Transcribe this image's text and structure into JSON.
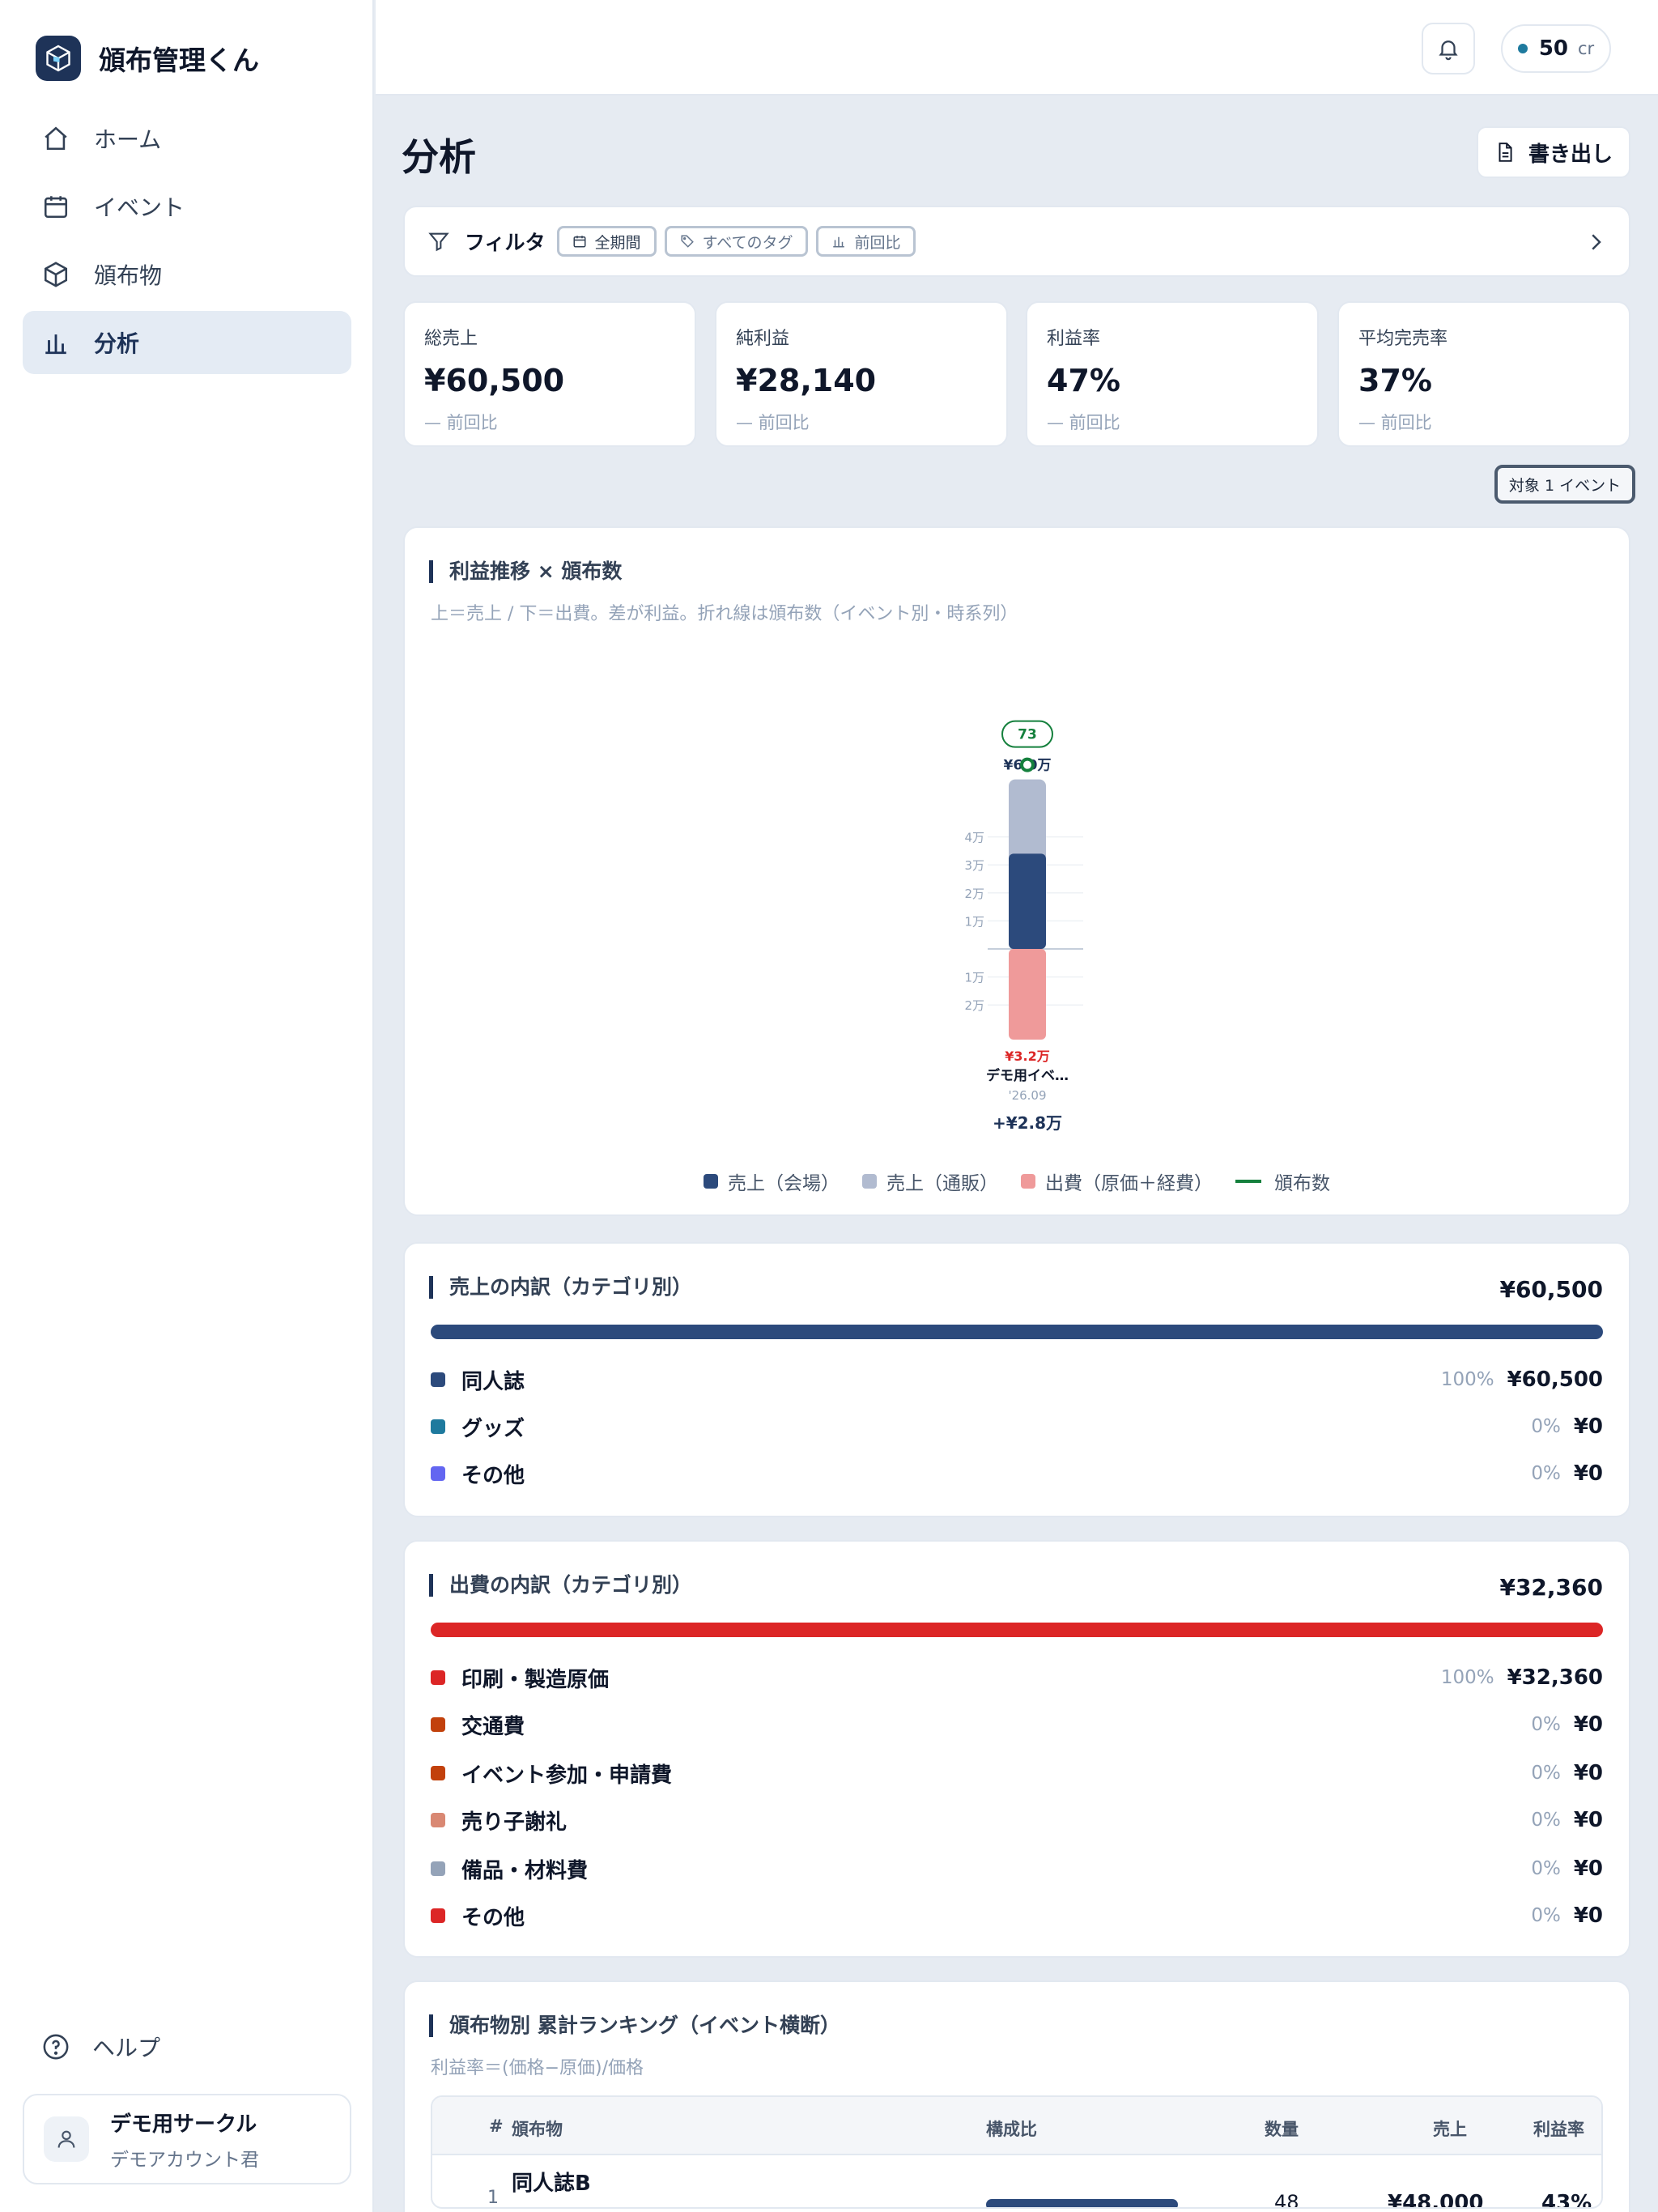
{
  "app": {
    "title": "頒布管理くん"
  },
  "nav": {
    "items": [
      {
        "label": "ホーム",
        "icon": "home-icon"
      },
      {
        "label": "イベント",
        "icon": "calendar-icon"
      },
      {
        "label": "頒布物",
        "icon": "box-icon"
      },
      {
        "label": "分析",
        "icon": "bar-chart-icon",
        "active": true
      }
    ]
  },
  "help": {
    "label": "ヘルプ"
  },
  "user": {
    "name": "デモ用サークル",
    "account": "デモアカウント君"
  },
  "topbar": {
    "credits": "50",
    "credit_unit": "cr"
  },
  "page": {
    "title": "分析",
    "export_label": "書き出し"
  },
  "filter": {
    "label": "フィルタ",
    "chips": [
      "全期間",
      "すべてのタグ",
      "前回比"
    ]
  },
  "kpis": [
    {
      "label": "総売上",
      "value": "¥60,500",
      "sub": "— 前回比"
    },
    {
      "label": "純利益",
      "value": "¥28,140",
      "sub": "— 前回比"
    },
    {
      "label": "利益率",
      "value": "47%",
      "sub": "— 前回比"
    },
    {
      "label": "平均完売率",
      "value": "37%",
      "sub": "— 前回比"
    }
  ],
  "target_badge": "対象 1 イベント",
  "profit_chart": {
    "title": "利益推移 × 頒布数",
    "subtitle": "上＝売上 / 下＝出費。差が利益。折れ線は頒布数（イベント別・時系列）",
    "legend": [
      "売上（会場）",
      "売上（通販）",
      "出費（原価＋経費）",
      "頒布数"
    ]
  },
  "chart_data": {
    "type": "bar",
    "categories": [
      "デモ用イベ…"
    ],
    "category_dates": [
      "'26.09"
    ],
    "y_ticks_positive": [
      "1万",
      "2万",
      "3万",
      "4万"
    ],
    "y_ticks_negative": [
      "1万",
      "2万"
    ],
    "series": [
      {
        "name": "売上（会場）",
        "values": [
          34000
        ],
        "color": "#2c4a7c"
      },
      {
        "name": "売上（通販）",
        "values": [
          26500
        ],
        "color": "#b1bbd0"
      },
      {
        "name": "出費（原価＋経費）",
        "values": [
          -32360
        ],
        "color": "#ef9a9a"
      },
      {
        "name": "頒布数",
        "values": [
          73
        ],
        "color": "#15803d"
      }
    ],
    "top_label": "¥6.0万",
    "bottom_label": "¥3.2万",
    "count_label": "73",
    "profit_label": "+¥2.8万"
  },
  "sales_breakdown": {
    "title": "売上の内訳（カテゴリ別）",
    "total": "¥60,500",
    "bar_color": "#2c4a7c",
    "rows": [
      {
        "label": "同人誌",
        "pct": "100%",
        "value": "¥60,500",
        "color": "#2c4a7c"
      },
      {
        "label": "グッズ",
        "pct": "0%",
        "value": "¥0",
        "color": "#1e7a9e"
      },
      {
        "label": "その他",
        "pct": "0%",
        "value": "¥0",
        "color": "#6366f1"
      }
    ]
  },
  "expense_breakdown": {
    "title": "出費の内訳（カテゴリ別）",
    "total": "¥32,360",
    "bar_color": "#dc2626",
    "rows": [
      {
        "label": "印刷・製造原価",
        "pct": "100%",
        "value": "¥32,360",
        "color": "#dc2626"
      },
      {
        "label": "交通費",
        "pct": "0%",
        "value": "¥0",
        "color": "#c2410c"
      },
      {
        "label": "イベント参加・申請費",
        "pct": "0%",
        "value": "¥0",
        "color": "#c2410c"
      },
      {
        "label": "売り子謝礼",
        "pct": "0%",
        "value": "¥0",
        "color": "#d98873"
      },
      {
        "label": "備品・材料費",
        "pct": "0%",
        "value": "¥0",
        "color": "#94a3b8"
      },
      {
        "label": "その他",
        "pct": "0%",
        "value": "¥0",
        "color": "#dc2626"
      }
    ]
  },
  "ranking": {
    "title": "頒布物別 累計ランキング（イベント横断）",
    "subtitle": "利益率＝(価格−原価)/価格",
    "columns": [
      "#",
      "頒布物",
      "構成比",
      "数量",
      "売上",
      "利益率"
    ],
    "rows": [
      {
        "rank": "1",
        "name": "同人誌B",
        "share": 0.79,
        "qty": "48",
        "sales": "¥48,000",
        "margin": "43%"
      }
    ]
  }
}
